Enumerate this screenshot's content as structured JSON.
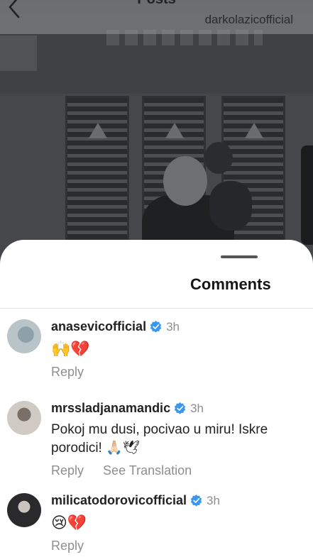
{
  "nav": {
    "title": "Posts",
    "handle": "darkolazicofficial"
  },
  "sheet": {
    "title": "Comments"
  },
  "comments": [
    {
      "username": "anasevicofficial",
      "verified": true,
      "time": "3h",
      "lines": [
        "🙌💔"
      ],
      "actions": [
        "Reply"
      ]
    },
    {
      "username": "mrssladjanamandic",
      "verified": true,
      "time": "3h",
      "lines": [
        "Pokoj mu dusi, pocivao u miru! Iskre",
        "porodici! 🙏🏻🕊"
      ],
      "actions": [
        "Reply",
        "See Translation"
      ]
    },
    {
      "username": "milicatodorovicofficial",
      "verified": true,
      "time": "3h",
      "lines": [
        "😢💔"
      ],
      "actions": [
        "Reply"
      ]
    }
  ],
  "icons": {
    "back": "chevron-left-icon",
    "verified": "verified-badge-icon"
  },
  "colors": {
    "verified": "#3897f0",
    "secondary_text": "#8e8e8e",
    "sheet_bg": "#ffffff"
  }
}
